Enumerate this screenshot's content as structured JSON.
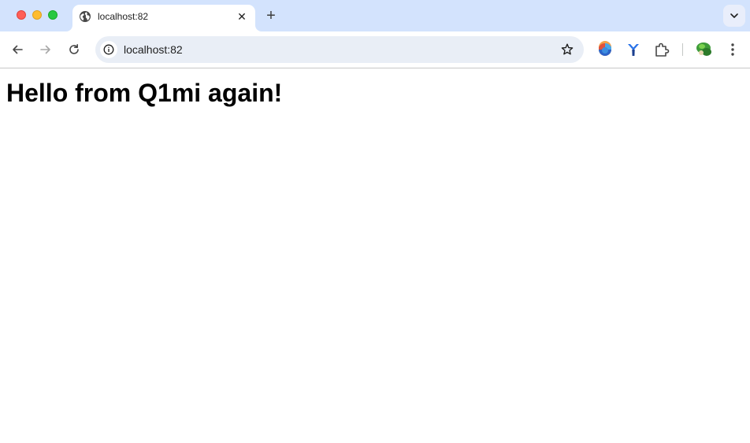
{
  "browser": {
    "tab": {
      "title": "localhost:82",
      "icon": "globe-icon"
    },
    "address_bar": {
      "url": "localhost:82"
    },
    "colors": {
      "tabstrip": "#d3e3fd",
      "omnibox": "#e9eef6"
    }
  },
  "page": {
    "heading": "Hello from Q1mi again!"
  }
}
